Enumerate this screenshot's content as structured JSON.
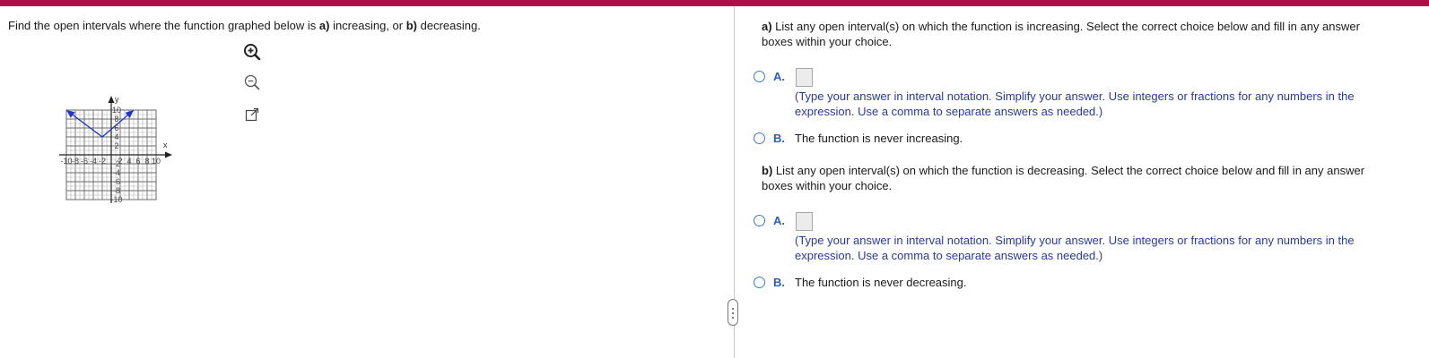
{
  "prompt": {
    "pre": "Find the open intervals where the function graphed below is ",
    "a_bold": "a)",
    "mid": " increasing, or ",
    "b_bold": "b)",
    "post": " decreasing."
  },
  "graph": {
    "x_axis_label": "x",
    "y_axis_label": "y",
    "x_ticks": [
      "-10",
      "-8",
      "-6",
      "-4",
      "-2",
      "2",
      "4",
      "6",
      "8",
      "10"
    ],
    "y_ticks": [
      "10",
      "8",
      "6",
      "4",
      "2",
      "-2",
      "-4",
      "-6",
      "-8",
      "-10"
    ],
    "function_points": [
      [
        -10,
        10
      ],
      [
        -2,
        4
      ],
      [
        5,
        10
      ]
    ],
    "xlim": [
      -10,
      10
    ],
    "ylim": [
      -10,
      10
    ],
    "line_color": "#2233cc"
  },
  "tools": {
    "zoom_in": "zoom-in-icon",
    "zoom_out": "zoom-out-icon",
    "popout": "popout-icon"
  },
  "part_a": {
    "label": "a)",
    "question": " List any open interval(s) on which the function is increasing. Select the correct choice below and fill in any answer boxes within your choice.",
    "option_a_letter": "A.",
    "option_a_hint": "(Type your answer in interval notation. Simplify your answer. Use integers or fractions for any numbers in the expression. Use a comma to separate answers as needed.)",
    "option_b_letter": "B.",
    "option_b_text": "The function is never increasing."
  },
  "part_b": {
    "label": "b)",
    "question": " List any open interval(s) on which the function is decreasing. Select the correct choice below and fill in any answer boxes within your choice.",
    "option_a_letter": "A.",
    "option_a_hint": "(Type your answer in interval notation. Simplify your answer. Use integers or fractions for any numbers in the expression. Use a comma to separate answers as needed.)",
    "option_b_letter": "B.",
    "option_b_text": "The function is never decreasing."
  },
  "colors": {
    "brand_bar": "#b00d49",
    "radio_border": "#3a7bd5",
    "option_letter": "#2b5fb4",
    "hint_text": "#2a3a9a"
  }
}
